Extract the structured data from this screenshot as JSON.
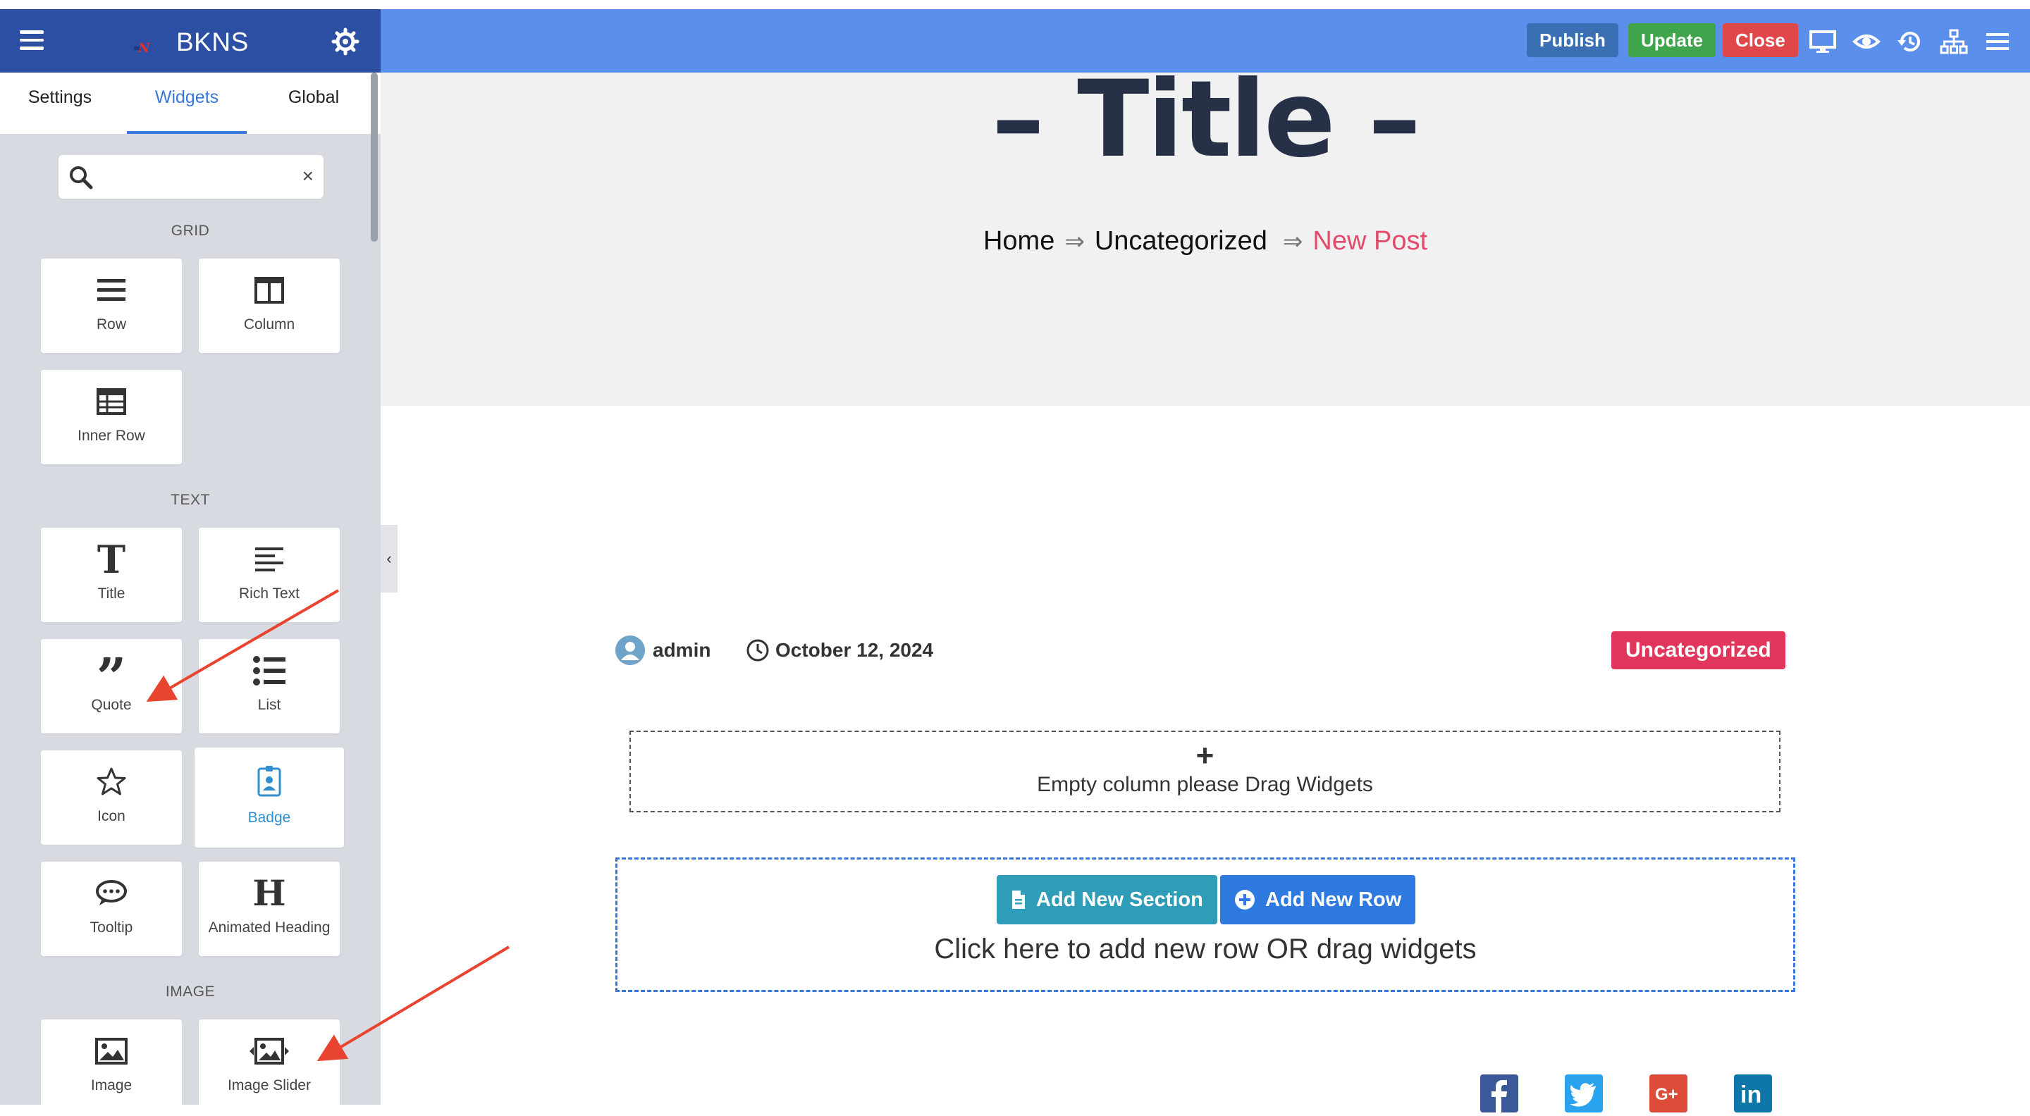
{
  "sidebar": {
    "brand": "BKNS",
    "brand_mark": "BKNS",
    "tabs": [
      "Settings",
      "Widgets",
      "Global"
    ],
    "active_tab": "Widgets",
    "search": {
      "value": "",
      "placeholder": ""
    },
    "sections": {
      "grid": {
        "title": "GRID",
        "items": [
          {
            "label": "Row",
            "icon": "row-icon"
          },
          {
            "label": "Column",
            "icon": "column-icon"
          },
          {
            "label": "Inner Row",
            "icon": "inner-row-icon"
          }
        ]
      },
      "text": {
        "title": "TEXT",
        "items": [
          {
            "label": "Title",
            "icon": "title-icon"
          },
          {
            "label": "Rich Text",
            "icon": "rich-text-icon"
          },
          {
            "label": "Quote",
            "icon": "quote-icon"
          },
          {
            "label": "List",
            "icon": "list-icon"
          },
          {
            "label": "Icon",
            "icon": "star-icon"
          },
          {
            "label": "Badge",
            "icon": "badge-icon"
          },
          {
            "label": "Tooltip",
            "icon": "tooltip-icon"
          },
          {
            "label": "Animated Heading",
            "icon": "animated-heading-icon"
          }
        ]
      },
      "image": {
        "title": "IMAGE",
        "items": [
          {
            "label": "Image",
            "icon": "image-icon"
          },
          {
            "label": "Image Slider",
            "icon": "image-slider-icon"
          }
        ]
      }
    },
    "collapse_glyph": "‹"
  },
  "toolbar": {
    "publish_label": "Publish",
    "update_label": "Update",
    "close_label": "Close",
    "icons": [
      "desktop-icon",
      "eye-icon",
      "history-icon",
      "sitemap-icon",
      "menu-icon"
    ]
  },
  "page": {
    "hero_title": "– Title –",
    "breadcrumb": {
      "home": "Home",
      "category": "Uncategorized",
      "current": "New Post",
      "separator": "⇒"
    },
    "meta": {
      "author": "admin",
      "date": "October 12, 2024",
      "category_badge": "Uncategorized"
    },
    "empty_column": {
      "plus": "+",
      "text": "Empty column please Drag Widgets"
    },
    "add_zone": {
      "add_section_label": "Add New Section",
      "add_row_label": "Add New Row",
      "hint": "Click here to add new row OR drag widgets"
    },
    "social_icons": [
      "facebook-icon",
      "twitter-icon",
      "google-plus-icon",
      "linkedin-icon"
    ]
  },
  "colors": {
    "sidebar_header": "#2d4fa3",
    "toolbar": "#5a8fec",
    "publish": "#3a6fb3",
    "update": "#3fa44b",
    "close": "#e0474a",
    "category_badge": "#e0365c",
    "breadcrumb_current": "#e24b6c",
    "annotation_arrow": "#e8442f"
  }
}
